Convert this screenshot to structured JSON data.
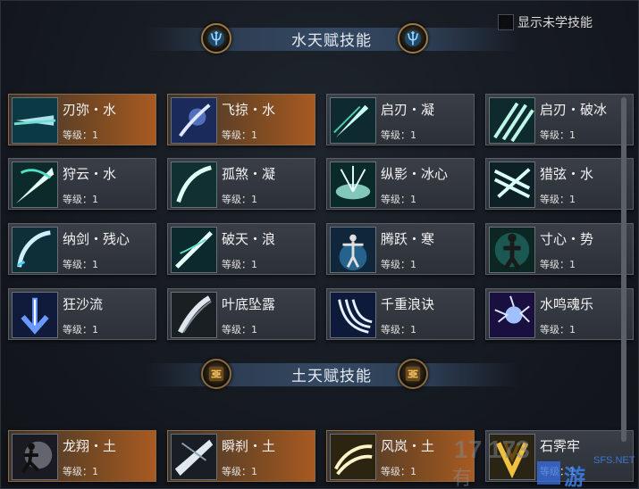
{
  "show_unlearned": {
    "label": "显示未学技能",
    "checked": false
  },
  "sections": [
    {
      "title": "水天赋技能",
      "emblem": "water-trident-icon",
      "skills": [
        {
          "name": "刃弥・水",
          "level": "等级：1",
          "learned": true,
          "icon": "blade-strike-icon"
        },
        {
          "name": "飞掠・水",
          "level": "等级：1",
          "learned": true,
          "icon": "flying-slash-icon"
        },
        {
          "name": "启刃・凝",
          "level": "等级：1",
          "learned": false,
          "icon": "blade-start-icon"
        },
        {
          "name": "启刃・破冰",
          "level": "等级：1",
          "learned": false,
          "icon": "triple-blade-icon"
        },
        {
          "name": "狩云・水",
          "level": "等级：1",
          "learned": false,
          "icon": "cloud-hunt-icon"
        },
        {
          "name": "孤煞・凝",
          "level": "等级：1",
          "learned": false,
          "icon": "lone-slash-icon"
        },
        {
          "name": "纵影・冰心",
          "level": "等级：1",
          "learned": false,
          "icon": "shadow-burst-icon"
        },
        {
          "name": "猎弦・水",
          "level": "等级：1",
          "learned": false,
          "icon": "hunter-string-icon"
        },
        {
          "name": "纳剑・残心",
          "level": "等级：1",
          "learned": false,
          "icon": "sword-arc-icon"
        },
        {
          "name": "破天・浪",
          "level": "等级：1",
          "learned": false,
          "icon": "sky-breaker-icon"
        },
        {
          "name": "腾跃・寒",
          "level": "等级：1",
          "learned": false,
          "icon": "leap-figure-icon"
        },
        {
          "name": "寸心・势",
          "level": "等级：1",
          "learned": false,
          "icon": "stance-figure-icon"
        },
        {
          "name": "狂沙流",
          "level": "等级：1",
          "learned": false,
          "icon": "down-arrow-icon"
        },
        {
          "name": "叶底坠露",
          "level": "等级：1",
          "learned": false,
          "icon": "falling-dew-icon"
        },
        {
          "name": "千重浪诀",
          "level": "等级：1",
          "learned": false,
          "icon": "wave-claw-icon"
        },
        {
          "name": "水鸣魂乐",
          "level": "等级：1",
          "learned": false,
          "icon": "lightning-orb-icon"
        }
      ]
    },
    {
      "title": "土天赋技能",
      "emblem": "earth-sigil-icon",
      "skills": [
        {
          "name": "龙翔・土",
          "level": "等级：1",
          "learned": true,
          "icon": "dragon-dash-icon"
        },
        {
          "name": "瞬刹・土",
          "level": "等级：1",
          "learned": true,
          "icon": "instant-strike-icon"
        },
        {
          "name": "风岚・土",
          "level": "等级：1",
          "learned": true,
          "icon": "wind-storm-icon"
        },
        {
          "name": "石霁牢",
          "level": "等级：1",
          "learned": false,
          "icon": "stone-prison-icon"
        }
      ]
    }
  ],
  "watermark": {
    "text": "SFS.NET",
    "brand": "17173 有游"
  }
}
